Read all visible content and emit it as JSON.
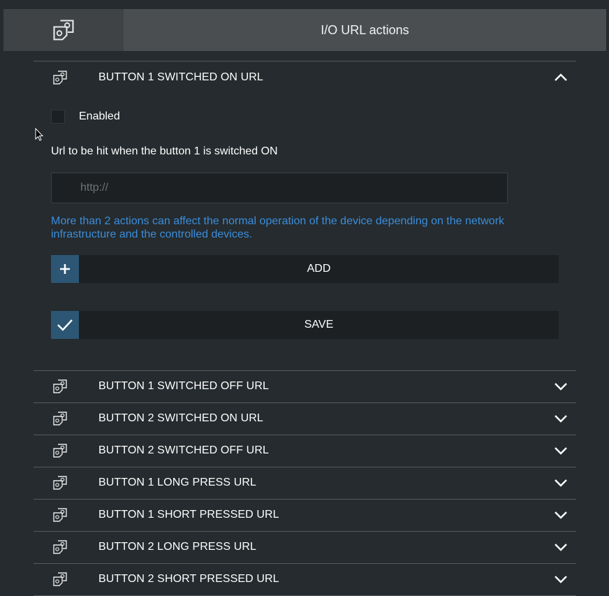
{
  "header": {
    "title": "I/O URL actions",
    "icon": "io-device-icon"
  },
  "expanded_section": {
    "title": "BUTTON 1 SWITCHED ON URL",
    "icon": "io-device-icon",
    "chevron": "chevron-up-icon",
    "enabled_label": "Enabled",
    "enabled_checked": false,
    "url_label": "Url to be hit when the button 1 is switched ON",
    "url_value": "",
    "url_placeholder": "http://",
    "warning": "More than 2 actions can affect the normal operation of the device depending on the network infrastructure and the controlled devices.",
    "add_label": "ADD",
    "save_label": "SAVE"
  },
  "collapsed_sections": [
    {
      "title": "BUTTON 1 SWITCHED OFF URL"
    },
    {
      "title": "BUTTON 2 SWITCHED ON URL"
    },
    {
      "title": "BUTTON 2 SWITCHED OFF URL"
    },
    {
      "title": "BUTTON 1 LONG PRESS URL"
    },
    {
      "title": "BUTTON 1 SHORT PRESSED URL"
    },
    {
      "title": "BUTTON 2 LONG PRESS URL"
    },
    {
      "title": "BUTTON 2 SHORT PRESSED URL"
    }
  ],
  "colors": {
    "background": "#252b2e",
    "header": "#4a4e51",
    "accent": "#2c5674",
    "warning_text": "#3c8ddb"
  }
}
